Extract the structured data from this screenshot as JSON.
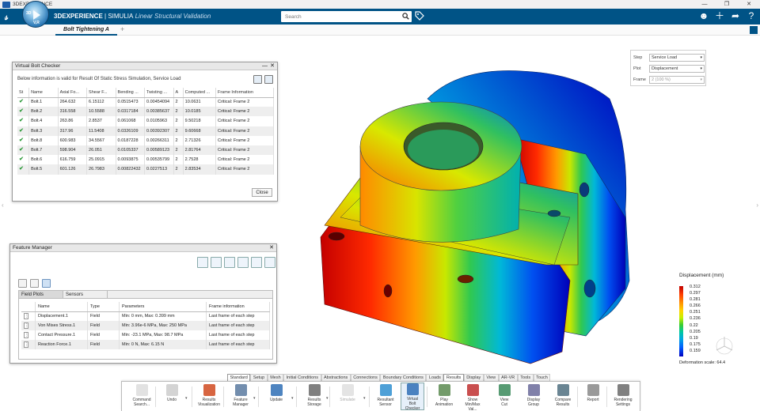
{
  "os": {
    "title": "3DEXPERIENCE",
    "controls": [
      "—",
      "❐",
      "✕"
    ]
  },
  "header": {
    "brand_bold": "3DEXPERIENCE",
    "brand_sep": " | ",
    "brand_app": "SIMULIA",
    "brand_sub": " Linear Structural Validation",
    "compass_3d": "3D",
    "compass_version": "V,R",
    "search_placeholder": "Search"
  },
  "tabs": {
    "active": "Bolt Tightening A",
    "add": "+"
  },
  "bolt_checker": {
    "title": "Virtual Bolt Checker",
    "info": "Below information is valid for Result Of Static Stress Simulation, Service Load",
    "columns": [
      "St",
      "Name",
      "Axial Fo...",
      "Shear F...",
      "Bending ...",
      "Twisting ...",
      "A",
      "Computed ...",
      "Frame Information"
    ],
    "rows": [
      [
        "Bolt.1",
        "264.632",
        "6.15112",
        "0.0515473",
        "0.00454094",
        "2",
        "10.0631",
        "Critical: Frame 2"
      ],
      [
        "Bolt.2",
        "316.558",
        "10.5588",
        "0.0317184",
        "0.00385637",
        "2",
        "10.0185",
        "Critical: Frame 2"
      ],
      [
        "Bolt.4",
        "263.86",
        "2.8537",
        "0.061068",
        "0.0105963",
        "2",
        "9.50218",
        "Critical: Frame 2"
      ],
      [
        "Bolt.3",
        "317.96",
        "11.5408",
        "0.0326109",
        "0.00392307",
        "2",
        "9.60668",
        "Critical: Frame 2"
      ],
      [
        "Bolt.8",
        "600.983",
        "34.5567",
        "0.0187228",
        "0.00266311",
        "2",
        "2.71326",
        "Critical: Frame 2"
      ],
      [
        "Bolt.7",
        "598.904",
        "26.051",
        "0.0105337",
        "0.00589123",
        "2",
        "2.81764",
        "Critical: Frame 2"
      ],
      [
        "Bolt.6",
        "616.759",
        "25.0915",
        "0.0093875",
        "0.00535799",
        "2",
        "2.7528",
        "Critical: Frame 2"
      ],
      [
        "Bolt.5",
        "601.126",
        "26.7983",
        "0.00822432",
        "0.0227513",
        "2",
        "2.83534",
        "Critical: Frame 2"
      ]
    ],
    "close_label": "Close"
  },
  "feature_manager": {
    "title": "Feature Manager",
    "tabs": [
      "Field Plots",
      "Sensors"
    ],
    "columns": [
      "Name",
      "Type",
      "Parameters",
      "Frame information"
    ],
    "rows": [
      [
        "Displacement.1",
        "Field",
        "Min: 0 mm, Max: 0.399 mm",
        "Last frame of each step"
      ],
      [
        "Von Mises Stress.1",
        "Field",
        "Min: 3.96e-6 MPa, Max: 250 MPa",
        "Last frame of each step"
      ],
      [
        "Contact Pressure.1",
        "Field",
        "Min: -23.1 MPa, Max: 98.7 MPa",
        "Last frame of each step"
      ],
      [
        "Reaction Force.1",
        "Field",
        "Min: 0 N, Max: 6.15 N",
        "Last frame of each step"
      ]
    ]
  },
  "step_panel": {
    "step_label": "Step",
    "step_value": "Service Load",
    "plot_label": "Plot",
    "plot_value": "Displacement",
    "frame_label": "Frame",
    "frame_value": "2 (100 %)"
  },
  "legend": {
    "title": "Displacement (mm)",
    "ticks": [
      "0.312",
      "0.297",
      "0.281",
      "0.266",
      "0.251",
      "0.236",
      "0.22",
      "0.205",
      "0.19",
      "0.175",
      "0.159"
    ],
    "scale": "Deformation scale: 64.4"
  },
  "section_tabs": [
    "Standard",
    "Setup",
    "Mesh",
    "Initial Conditions",
    "Abstractions",
    "Connections",
    "Boundary Conditions",
    "Loads",
    "Results",
    "Display",
    "View",
    "AR-VR",
    "Tools",
    "Touch"
  ],
  "section_tabs_selected": [
    "Standard",
    "Results"
  ],
  "actions": [
    {
      "l1": "Command",
      "l2": "Search..."
    },
    {
      "l1": "Undo",
      "l2": ""
    },
    {
      "l1": "Results",
      "l2": "Visualization"
    },
    {
      "l1": "Feature",
      "l2": "Manager"
    },
    {
      "l1": "Update",
      "l2": ""
    },
    {
      "l1": "Results",
      "l2": "Storage"
    },
    {
      "l1": "Simulate",
      "l2": ""
    },
    {
      "l1": "Resultant",
      "l2": "Sensor"
    },
    {
      "l1": "Virtual",
      "l2": "Bolt Checker"
    },
    {
      "l1": "Play",
      "l2": "Animation"
    },
    {
      "l1": "Show",
      "l2": "Min/Max Val..."
    },
    {
      "l1": "View",
      "l2": "Cut"
    },
    {
      "l1": "Display",
      "l2": "Group"
    },
    {
      "l1": "Compare",
      "l2": "Results"
    },
    {
      "l1": "Report",
      "l2": ""
    },
    {
      "l1": "Rendering",
      "l2": "Settings"
    }
  ],
  "colors": {
    "header": "#005386",
    "accent_check": "#2e9a3a"
  }
}
